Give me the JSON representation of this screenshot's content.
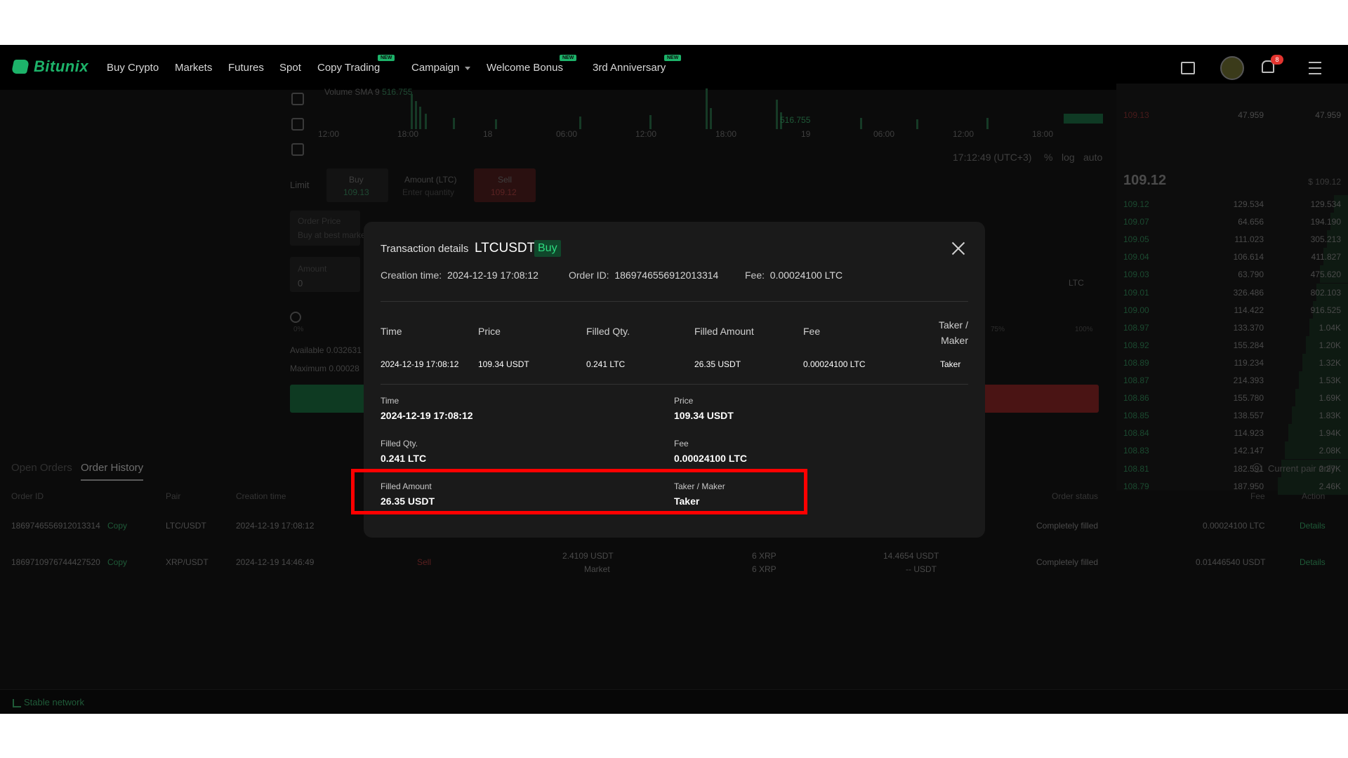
{
  "brand": {
    "name": "Bitunix"
  },
  "nav": {
    "items": [
      {
        "label": "Buy Crypto"
      },
      {
        "label": "Markets"
      },
      {
        "label": "Futures"
      },
      {
        "label": "Spot"
      },
      {
        "label": "Copy Trading",
        "badge": "NEW"
      },
      {
        "label": "Campaign"
      },
      {
        "label": "Welcome Bonus",
        "badge": "NEW"
      },
      {
        "label": "3rd Anniversary",
        "badge": "NEW"
      }
    ],
    "notification_count": "8"
  },
  "background": {
    "chart": {
      "volume_label": "Volume SMA 9",
      "volume_value": "516.755",
      "time_ticks": [
        "12:00",
        "18:00",
        "18",
        "06:00",
        "12:00",
        "18:00",
        "19",
        "06:00",
        "12:00",
        "18:00"
      ],
      "clock": "17:12:49 (UTC+3)",
      "scale_options": [
        "%",
        "log",
        "auto"
      ],
      "current_badge": "516.755"
    },
    "order_form": {
      "limit_label": "Limit",
      "buy_label": "Buy",
      "buy_price": "109.13",
      "amount_label": "Amount (LTC)",
      "amount_placeholder": "Enter quantity",
      "sell_label": "Sell",
      "sell_price": "109.12",
      "order_price_label": "Order Price",
      "order_price_placeholder": "Buy at best market",
      "amount_field_label": "Amount",
      "amount_value": "0",
      "unit": "LTC",
      "pct_0": "0%",
      "pct_75": "75%",
      "pct_100": "100%",
      "available_label": "Available",
      "available_value": "0.032631",
      "maximum_label": "Maximum",
      "maximum_value": "0.00028"
    },
    "orderbook": {
      "top_rows": [
        {
          "price": "109.13",
          "amount": "47.959",
          "total": "47.959"
        }
      ],
      "mid_price": "109.12",
      "mid_usd": "$ 109.12",
      "rows": [
        {
          "price": "109.12",
          "amount": "129.534",
          "total": "129.534"
        },
        {
          "price": "109.07",
          "amount": "64.656",
          "total": "194.190"
        },
        {
          "price": "109.05",
          "amount": "111.023",
          "total": "305.213"
        },
        {
          "price": "109.04",
          "amount": "106.614",
          "total": "411.827"
        },
        {
          "price": "109.03",
          "amount": "63.790",
          "total": "475.620"
        },
        {
          "price": "109.01",
          "amount": "326.486",
          "total": "802.103"
        },
        {
          "price": "109.00",
          "amount": "114.422",
          "total": "916.525"
        },
        {
          "price": "108.97",
          "amount": "133.370",
          "total": "1.04K"
        },
        {
          "price": "108.92",
          "amount": "155.284",
          "total": "1.20K"
        },
        {
          "price": "108.89",
          "amount": "119.234",
          "total": "1.32K"
        },
        {
          "price": "108.87",
          "amount": "214.393",
          "total": "1.53K"
        },
        {
          "price": "108.86",
          "amount": "155.780",
          "total": "1.69K"
        },
        {
          "price": "108.85",
          "amount": "138.557",
          "total": "1.83K"
        },
        {
          "price": "108.84",
          "amount": "114.923",
          "total": "1.94K"
        },
        {
          "price": "108.83",
          "amount": "142.147",
          "total": "2.08K"
        },
        {
          "price": "108.81",
          "amount": "182.591",
          "total": "2.27K"
        },
        {
          "price": "108.79",
          "amount": "187.950",
          "total": "2.46K"
        }
      ]
    },
    "orders": {
      "tabs": [
        "Open Orders",
        "Order History"
      ],
      "current_pair_only": "Current pair only",
      "headers": {
        "order_id": "Order ID",
        "pair": "Pair",
        "creation_time": "Creation time",
        "order_status": "Order status",
        "fee": "Fee",
        "action": "Action"
      },
      "rows": [
        {
          "order_id": "1869746556912013314",
          "copy": "Copy",
          "pair": "LTC/USDT",
          "time": "2024-12-19 17:08:12",
          "side": "",
          "price": "",
          "price_sub": "",
          "qty": "",
          "qty_sub": "",
          "amount": "",
          "amount_sub": "",
          "status": "Completely filled",
          "fee": "0.00024100 LTC",
          "action": "Details"
        },
        {
          "order_id": "1869710976744427520",
          "copy": "Copy",
          "pair": "XRP/USDT",
          "time": "2024-12-19 14:46:49",
          "side": "Sell",
          "price": "2.4109 USDT",
          "price_sub": "Market",
          "qty": "6 XRP",
          "qty_sub": "6 XRP",
          "amount": "14.4654 USDT",
          "amount_sub": "-- USDT",
          "status": "Completely filled",
          "fee": "0.01446540 USDT",
          "action": "Details"
        }
      ]
    },
    "status": "Stable network"
  },
  "modal": {
    "title": "Transaction details",
    "pair": "LTCUSDT",
    "side": "Buy",
    "creation_label": "Creation time:",
    "creation_value": "2024-12-19 17:08:12",
    "order_id_label": "Order ID:",
    "order_id_value": "1869746556912013314",
    "fee_label": "Fee:",
    "fee_value": "0.00024100 LTC",
    "table": {
      "headers": [
        "Time",
        "Price",
        "Filled Qty.",
        "Filled Amount",
        "Fee",
        "Taker / Maker"
      ],
      "row": [
        "2024-12-19 17:08:12",
        "109.34 USDT",
        "0.241 LTC",
        "26.35 USDT",
        "0.00024100 LTC",
        "Taker"
      ]
    },
    "details": [
      {
        "label": "Time",
        "value": "2024-12-19 17:08:12"
      },
      {
        "label": "Price",
        "value": "109.34 USDT"
      },
      {
        "label": "Filled Qty.",
        "value": "0.241 LTC"
      },
      {
        "label": "Fee",
        "value": "0.00024100 LTC"
      },
      {
        "label": "Filled Amount",
        "value": "26.35 USDT"
      },
      {
        "label": "Taker / Maker",
        "value": "Taker"
      }
    ]
  },
  "colors": {
    "accent_green": "#1db36a",
    "buy_green": "#2ddc80",
    "highlight": "#ff0000"
  }
}
